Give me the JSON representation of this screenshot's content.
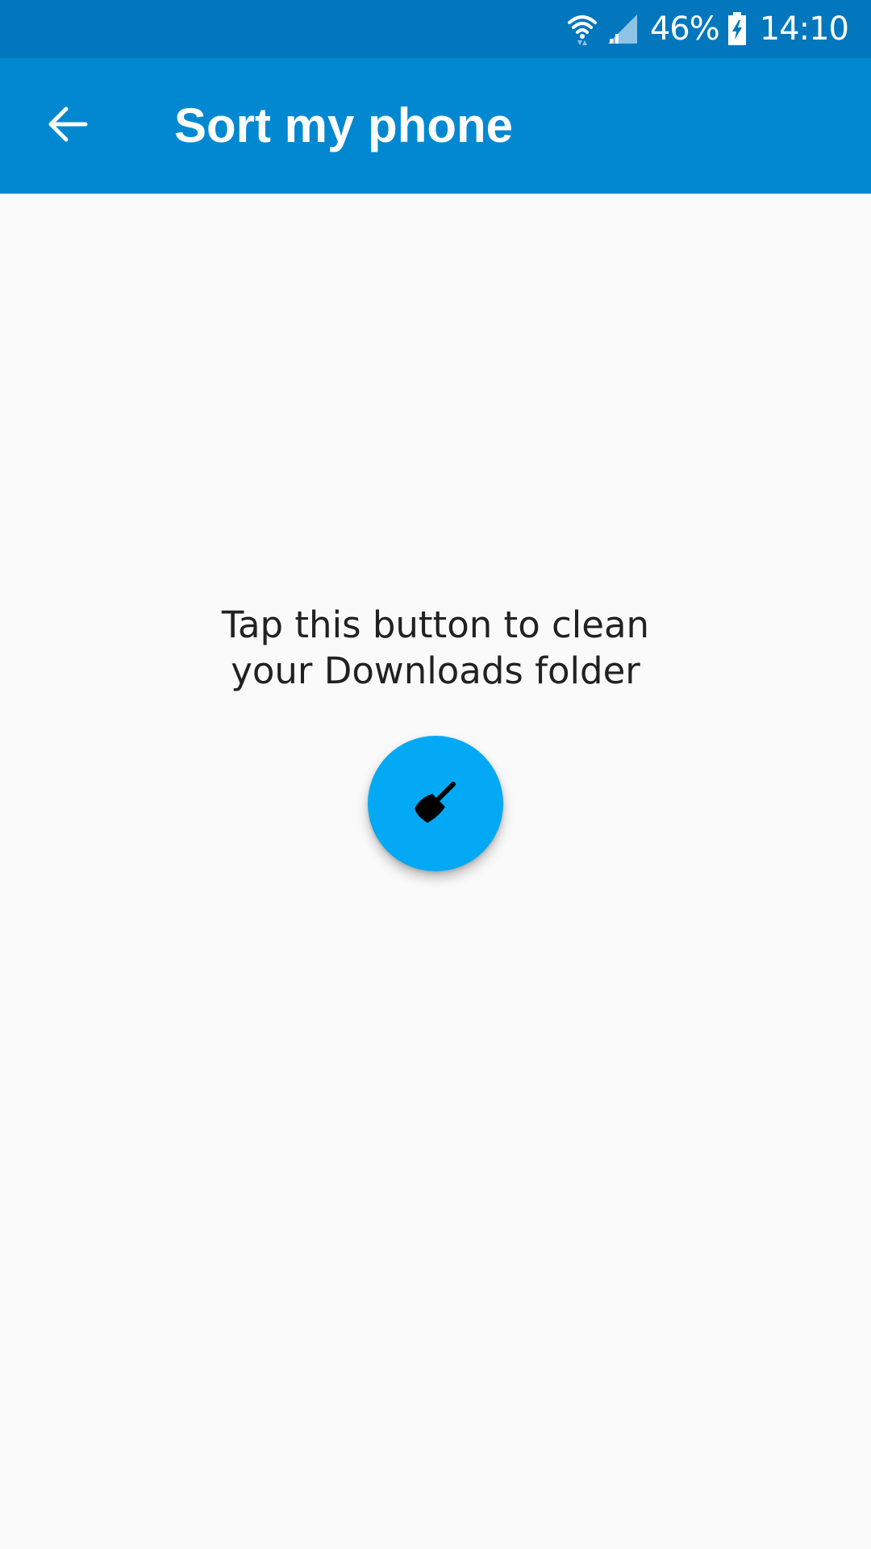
{
  "status_bar": {
    "battery_percent": "46%",
    "time": "14:10",
    "icons": [
      "wifi-icon",
      "signal-icon",
      "battery-charging-icon"
    ]
  },
  "app_bar": {
    "title": "Sort my phone",
    "back_icon": "arrow-back-icon"
  },
  "main": {
    "instruction_line1": "Tap this button to clean",
    "instruction_line2": "your Downloads folder",
    "clean_button_icon": "broom-icon"
  },
  "colors": {
    "status_bar": "#0277bd",
    "app_bar": "#0288d1",
    "fab": "#03a9f4",
    "background": "#fafafa",
    "text": "#212121"
  }
}
